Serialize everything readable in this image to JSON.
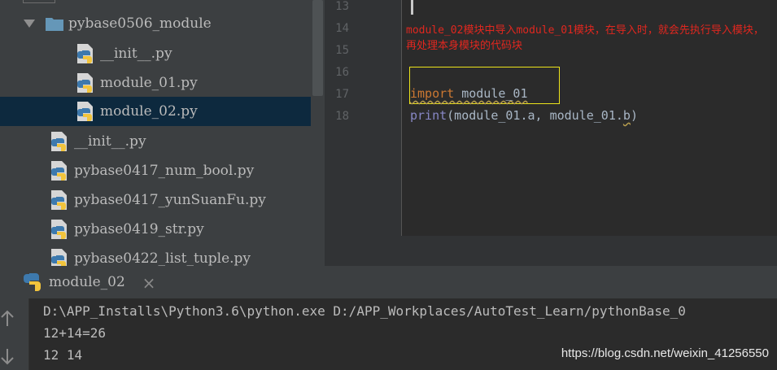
{
  "project_tree": {
    "items": [
      {
        "label": "pybase0506_module",
        "icon": "folder-icon",
        "expanded": true
      },
      {
        "label": "__init__.py",
        "icon": "python-file-icon"
      },
      {
        "label": "module_01.py",
        "icon": "python-file-icon"
      },
      {
        "label": "module_02.py",
        "icon": "python-file-icon",
        "selected": true
      },
      {
        "label": "__init__.py",
        "icon": "python-file-icon"
      },
      {
        "label": "pybase0417_num_bool.py",
        "icon": "python-file-icon"
      },
      {
        "label": "pybase0417_yunSuanFu.py",
        "icon": "python-file-icon"
      },
      {
        "label": "pybase0419_str.py",
        "icon": "python-file-icon"
      },
      {
        "label": "pybase0422_list_tuple.py",
        "icon": "python-file-icon"
      }
    ]
  },
  "editor": {
    "line_numbers": [
      "13",
      "14",
      "15",
      "16",
      "17",
      "18"
    ],
    "annotation": "module_02模块中导入module_01模块，在导入时，就会先执行导入模块，再处理本身模块的代码块",
    "import_keyword": "import",
    "import_module": "module_01",
    "print_builtin": "print",
    "print_args_open": "(module_01.a, module_01.",
    "print_args_last": "b",
    "print_close": ")"
  },
  "run_window": {
    "tab_label": "module_02",
    "close_glyph": "×",
    "console_lines": [
      "D:\\APP_Installs\\Python3.6\\python.exe D:/APP_Workplaces/AutoTest_Learn/pythonBase_0",
      "12+14=26",
      "12 14"
    ]
  },
  "watermark": "https://blog.csdn.net/weixin_41256550",
  "colors": {
    "annotation": "#e0271f",
    "highlight_box": "#ece41b",
    "keyword": "#cc7832",
    "builtin": "#8888c6",
    "selection": "#0d293e"
  }
}
